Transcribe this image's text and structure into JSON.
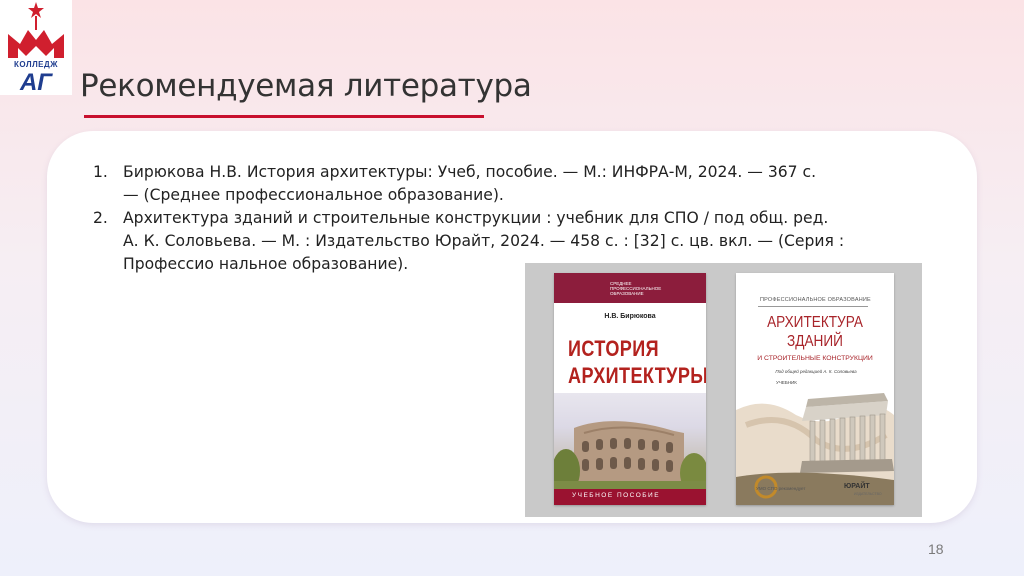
{
  "logo": {
    "college_label": "КОЛЛЕДЖ",
    "letters": "АГ"
  },
  "header": {
    "title": "Рекомендуемая литература"
  },
  "literature": [
    {
      "number": "1.",
      "line1": "Бирюкова Н.В. История архитектуры: Учеб, пособие. — М.: ИНФРА-М, 2024. — 367 с.",
      "line2": "— (Среднее профессиональное образование)."
    },
    {
      "number": "2.",
      "line1": "Архитектура зданий и строительные конструкции : учебник для СПО / под общ. ред.",
      "line2": "А. К. Соловьева. — М. : Издательство Юрайт, 2024. — 458 с. : [32] с. цв. вкл. — (Серия :",
      "line3": "Профессио нальное образование)."
    }
  ],
  "book1": {
    "series": "Среднее профессиональное образование",
    "author": "Н.В. Бирюкова",
    "title_line1": "ИСТОРИЯ",
    "title_line2": "АРХИТЕКТУРЫ",
    "footer": "УЧЕБНОЕ ПОСОБИЕ"
  },
  "book2": {
    "series": "ПРОФЕССИОНАЛЬНОЕ ОБРАЗОВАНИЕ",
    "title_line1": "АРХИТЕКТУРА",
    "title_line2": "ЗДАНИЙ",
    "subtitle": "И СТРОИТЕЛЬНЫЕ КОНСТРУКЦИИ",
    "editor": "Под общей редакцией А. К. Соловьева",
    "type": "УЧЕБНИК",
    "umo": "УМО СПО рекомендует",
    "publisher": "ЮРАЙТ",
    "publisher_sub": "ИЗДАТЕЛЬСТВО"
  },
  "page_number": "18",
  "colors": {
    "accent": "#c8102e",
    "logo_blue": "#1f3d8f",
    "book_maroon": "#8c1d3c"
  }
}
